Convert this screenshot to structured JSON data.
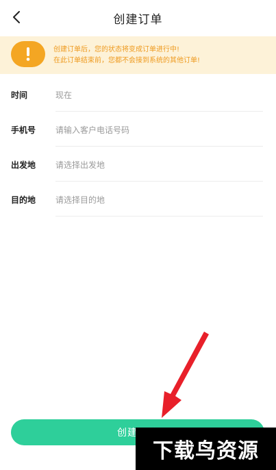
{
  "header": {
    "title": "创建订单",
    "back_icon": "chevron-left-icon"
  },
  "notice": {
    "icon": "exclamation-icon",
    "line1": "创建订单后，您的状态将变成订单进行中!",
    "line2": "在此订单结束前，您都不会接到系统的其他订单!"
  },
  "form": {
    "time": {
      "label": "时间",
      "value": "现在"
    },
    "phone": {
      "label": "手机号",
      "placeholder": "请输入客户电话号码"
    },
    "origin": {
      "label": "出发地",
      "placeholder": "请选择出发地"
    },
    "destination": {
      "label": "目的地",
      "placeholder": "请选择目的地"
    }
  },
  "submit": {
    "label": "创建订单"
  },
  "watermark": {
    "text": "下载鸟资源"
  },
  "colors": {
    "accent": "#2ecf9a",
    "notice_bg": "#fdf2d8",
    "notice_text": "#ee9a1f",
    "notice_icon": "#f4a623",
    "arrow": "#e8202a"
  }
}
